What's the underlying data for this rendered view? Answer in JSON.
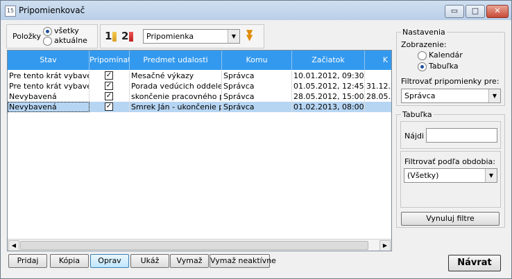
{
  "window": {
    "title": "Pripomienkovač",
    "icon": "calendar-icon",
    "min": "▭",
    "max": "□",
    "close": "✕"
  },
  "toolbar": {
    "polozky_label": "Položky",
    "radio_vsetky": "všetky",
    "radio_aktualne": "aktuálne",
    "radio_selected": "všetky",
    "sort_asc_icon": "sort-1-icon",
    "sort_asc_glyph": "1",
    "sort_desc_icon": "sort-2-icon",
    "sort_desc_glyph": "2",
    "type_combo_value": "Pripomienka",
    "expand_icon": "double-chevron-down-icon",
    "expand_glyph": "▼"
  },
  "table": {
    "headers": [
      "Stav",
      "Pripomínať",
      "Predmet udalosti",
      "Komu",
      "Začiatok",
      "K"
    ],
    "rows": [
      {
        "stav": "Pre tento krát vybavená",
        "pripominat": true,
        "predmet": "Mesačné výkazy",
        "komu": "Správca",
        "zaciatok": "10.01.2012, 09:30",
        "k": ""
      },
      {
        "stav": "Pre tento krát vybavená",
        "pripominat": true,
        "predmet": "Porada vedúcich oddelení",
        "komu": "Správca",
        "zaciatok": "01.05.2012, 12:45",
        "k": "31.12.2"
      },
      {
        "stav": "Nevybavená",
        "pripominat": true,
        "predmet": "skončenie pracovného pomeru",
        "komu": "Správca",
        "zaciatok": "28.05.2012, 15:00",
        "k": "28.05.2"
      },
      {
        "stav": "Nevybavená",
        "pripominat": true,
        "predmet": "Smrek Ján - ukončenie platnosti",
        "komu": "Správca",
        "zaciatok": "01.02.2013, 08:00",
        "k": ""
      }
    ],
    "selected_row": 3
  },
  "buttons": {
    "pridaj": "Pridaj",
    "kopia": "Kópia",
    "oprav": "Oprav",
    "ukaz": "Ukáž",
    "vymaz": "Vymaž",
    "vymaz_neaktivne": "Vymaž neaktívne",
    "navrat": "Návrat"
  },
  "settings": {
    "title": "Nastavenia",
    "zobrazenie_label": "Zobrazenie:",
    "opt_kalendar": "Kalendár",
    "opt_tabulka": "Tabuľka",
    "zobrazenie_selected": "Tabuľka",
    "filter_label": "Filtrovať pripomienky pre:",
    "filter_value": "Správca"
  },
  "tabulka_panel": {
    "title": "Tabuľka",
    "najdi_label": "Nájdi",
    "najdi_value": "",
    "obdobie_label": "Filtrovať podľa obdobia:",
    "obdobie_value": "(Všetky)",
    "reset_button": "Vynuluj filtre"
  },
  "colors": {
    "header_bg": "#3399ee",
    "selected_row_bg": "#b6d5f2"
  },
  "scrollbar": {
    "left_glyph": "◀",
    "right_glyph": "▶"
  }
}
